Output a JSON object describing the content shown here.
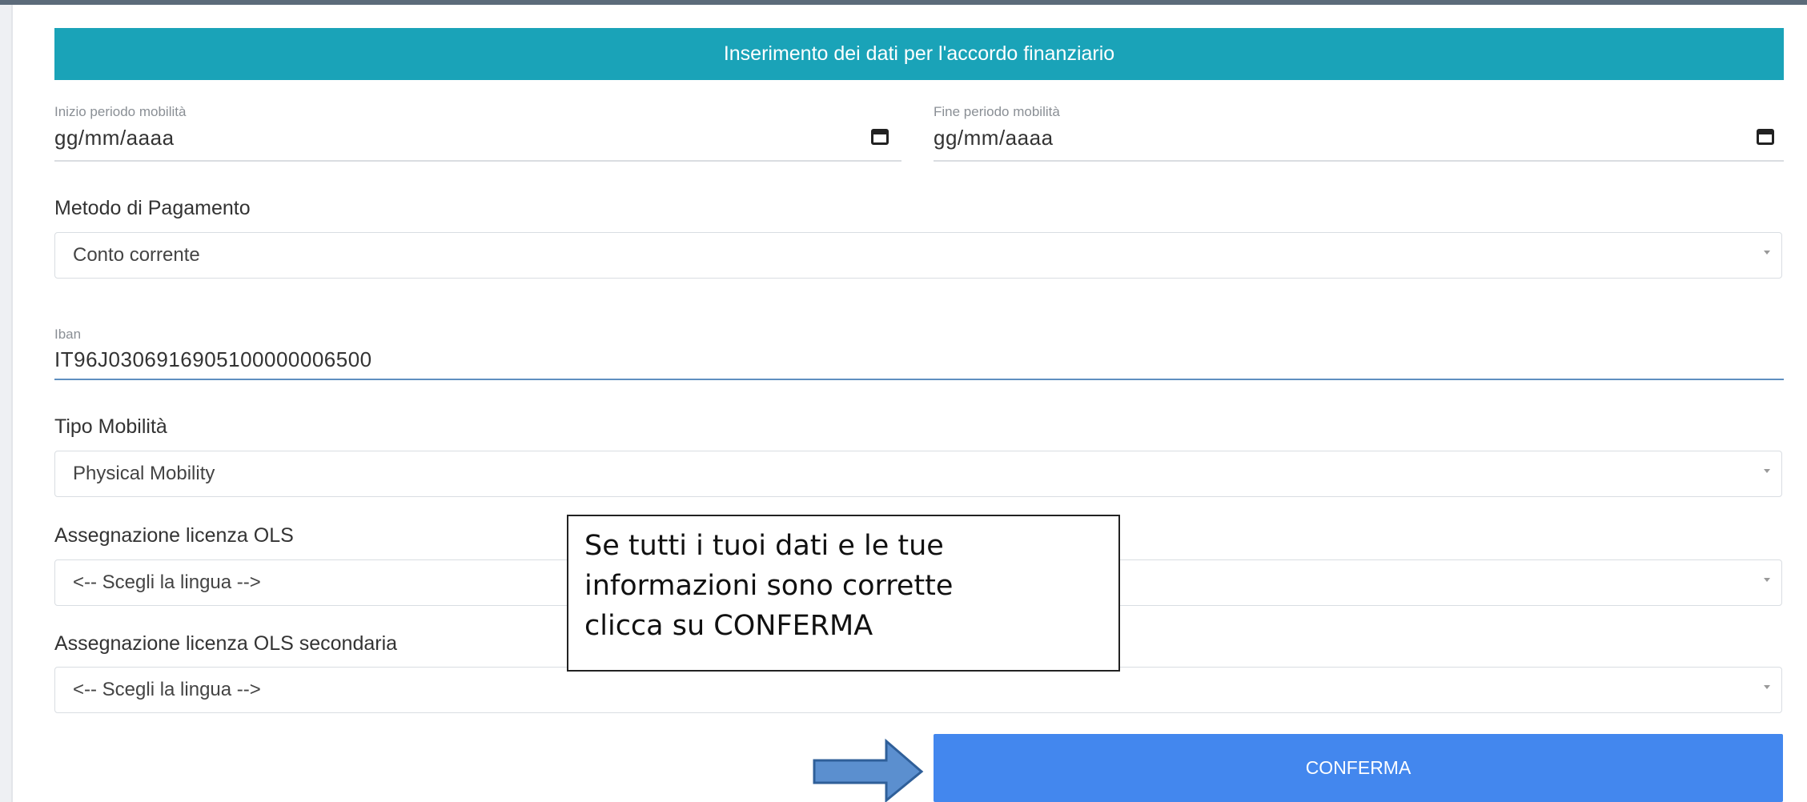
{
  "header": {
    "title": "Inserimento dei dati per l'accordo finanziario"
  },
  "mobility_period": {
    "start_label": "Inizio periodo mobilità",
    "start_placeholder": "gg/mm/aaaa",
    "end_label": "Fine periodo mobilità",
    "end_placeholder": "gg/mm/aaaa"
  },
  "payment": {
    "label": "Metodo di Pagamento",
    "selected": "Conto corrente"
  },
  "iban": {
    "label": "Iban",
    "value": "IT96J0306916905100000006500"
  },
  "mobility_type": {
    "label": "Tipo Mobilità",
    "selected": "Physical Mobility"
  },
  "ols_license": {
    "label": "Assegnazione licenza OLS",
    "selected": "<-- Scegli la lingua -->"
  },
  "ols_license_secondary": {
    "label": "Assegnazione licenza OLS secondaria",
    "selected": "<-- Scegli la lingua -->"
  },
  "callout": {
    "line1": "Se tutti i tuoi dati e le tue",
    "line2": "informazioni sono corrette",
    "line3": "clicca su CONFERMA"
  },
  "confirm_button": {
    "label": "CONFERMA"
  },
  "colors": {
    "header_bg": "#1aa3b8",
    "button_bg": "#4387ee",
    "arrow_fill": "#5b8fcf",
    "arrow_stroke": "#2f5f99"
  },
  "icons": {
    "date_picker": "calendar-icon",
    "select_caret": "caret-down-icon",
    "pointer_arrow": "right-arrow-icon"
  }
}
